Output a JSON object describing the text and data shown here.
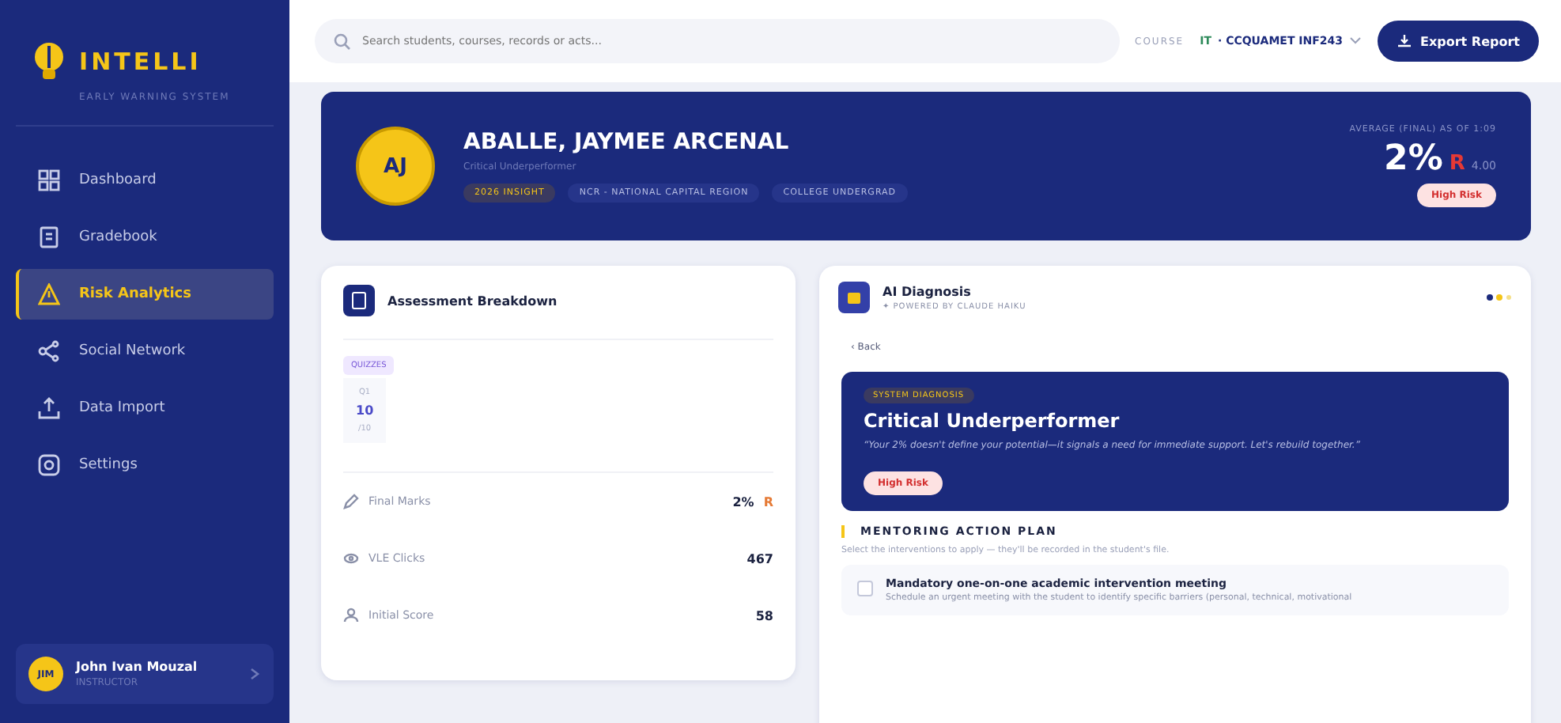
{
  "sidebar": {
    "logo": "INTELLI",
    "tagline": "EARLY WARNING SYSTEM",
    "items": [
      {
        "label": "Dashboard",
        "selected": false
      },
      {
        "label": "Gradebook",
        "selected": false
      },
      {
        "label": "Risk Analytics",
        "selected": true
      },
      {
        "label": "Social Network",
        "selected": false
      },
      {
        "label": "Data Import",
        "selected": false
      },
      {
        "label": "Settings",
        "selected": false
      }
    ],
    "user": {
      "initials": "JIM",
      "name": "John Ivan Mouzal",
      "role": "INSTRUCTOR"
    }
  },
  "topbar": {
    "search_placeholder": "Search students, courses, records or acts...",
    "course_label": "COURSE",
    "course_code": "IT",
    "course": "· CCQUAMET INF243",
    "export": "Export Report"
  },
  "student": {
    "initials": "AJ",
    "name": "ABALLE, JAYMEE ARCENAL",
    "status": "Critical Underperformer",
    "tags": [
      {
        "label": "2026 INSIGHT",
        "kind": "highlight"
      },
      {
        "label": "NCR - NATIONAL CAPITAL REGION",
        "kind": "plain"
      },
      {
        "label": "COLLEGE UNDERGRAD",
        "kind": "plain"
      }
    ],
    "score_label": "AVERAGE (FINAL) AS OF 1:09",
    "score": "2%",
    "grade": "R",
    "scale": "4.00",
    "risk": "High Risk"
  },
  "breakdown": {
    "title": "Assessment Breakdown",
    "chip": "QUIZZES",
    "quiz": {
      "label": "Q1",
      "score": "10",
      "max": "/10"
    },
    "rows": [
      {
        "label": "Final Marks",
        "value": "2%",
        "grade": "R"
      },
      {
        "label": "VLE Clicks",
        "value": "467"
      },
      {
        "label": "Initial Score",
        "value": "58"
      }
    ]
  },
  "diagnosis": {
    "title": "AI Diagnosis",
    "subtitle": "✦ POWERED BY CLAUDE HAIKU",
    "back": "‹ Back",
    "badge": "SYSTEM DIAGNOSIS",
    "headline": "Critical Underperformer",
    "quote": "“Your 2% doesn't define your potential—it signals a need for immediate support. Let's rebuild together.”",
    "risk": "High Risk",
    "plan_title": "MENTORING ACTION PLAN",
    "plan_hint": "Select the interventions to apply — they'll be recorded in the student's file.",
    "actions": [
      {
        "title": "Mandatory one-on-one academic intervention meeting",
        "detail": "Schedule an urgent meeting with the student to identify specific barriers (personal, technical, motivational",
        "checked": false
      }
    ]
  }
}
